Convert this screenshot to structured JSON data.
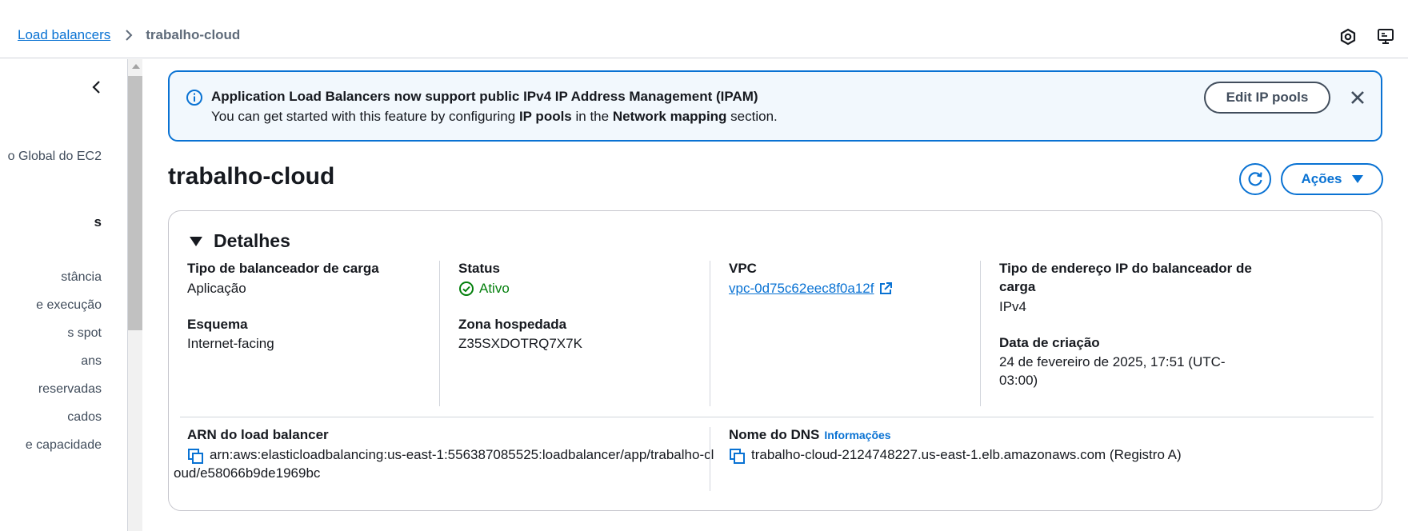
{
  "breadcrumb": {
    "parent": "Load balancers",
    "current": "trabalho-cloud"
  },
  "topbar_icons": [
    "settings-hex-icon",
    "feedback-screen-icon"
  ],
  "sidebar": {
    "items": [
      {
        "label": "o Global do EC2",
        "type": "item"
      },
      {
        "label": "s",
        "type": "heading"
      },
      {
        "label": "stância",
        "type": "item"
      },
      {
        "label": "e execução",
        "type": "item"
      },
      {
        "label": "s spot",
        "type": "item"
      },
      {
        "label": "ans",
        "type": "item"
      },
      {
        "label": "reservadas",
        "type": "item"
      },
      {
        "label": "cados",
        "type": "item"
      },
      {
        "label": "e capacidade",
        "type": "item"
      }
    ]
  },
  "flash": {
    "title": "Application Load Balancers now support public IPv4 IP Address Management (IPAM)",
    "text_before": "You can get started with this feature by configuring ",
    "text_bold1": "IP pools",
    "text_middle": " in the ",
    "text_bold2": "Network mapping",
    "text_after": " section.",
    "button": "Edit IP pools"
  },
  "header": {
    "title": "trabalho-cloud",
    "actions_label": "Ações"
  },
  "details": {
    "title": "Detalhes",
    "lb_type_label": "Tipo de balanceador de carga",
    "lb_type_value": "Aplicação",
    "scheme_label": "Esquema",
    "scheme_value": "Internet-facing",
    "status_label": "Status",
    "status_value": "Ativo",
    "hosted_zone_label": "Zona hospedada",
    "hosted_zone_value": "Z35SXDOTRQ7X7K",
    "vpc_label": "VPC",
    "vpc_value": "vpc-0d75c62eec8f0a12f",
    "ip_type_label_1": "Tipo de endereço IP do balanceador de",
    "ip_type_label_2": "carga",
    "ip_type_value": "IPv4",
    "created_label": "Data de criação",
    "created_value_1": "24 de fevereiro de 2025, 17:51 (UTC-",
    "created_value_2": "03:00)",
    "arn_label": "ARN do load balancer",
    "arn_value_1": "arn:aws:elasticloadbalancing:us-east-1:556387085525:loadbalancer/app/trabalho-cl",
    "arn_value_2": "oud/e58066b9de1969bc",
    "dns_label": "Nome do DNS",
    "dns_info": "Informações",
    "dns_value": "trabalho-cloud-2124748227.us-east-1.elb.amazonaws.com (Registro A)"
  },
  "colors": {
    "link": "#0972d3",
    "success": "#037f0c",
    "info_bg": "#f2f8fd"
  }
}
